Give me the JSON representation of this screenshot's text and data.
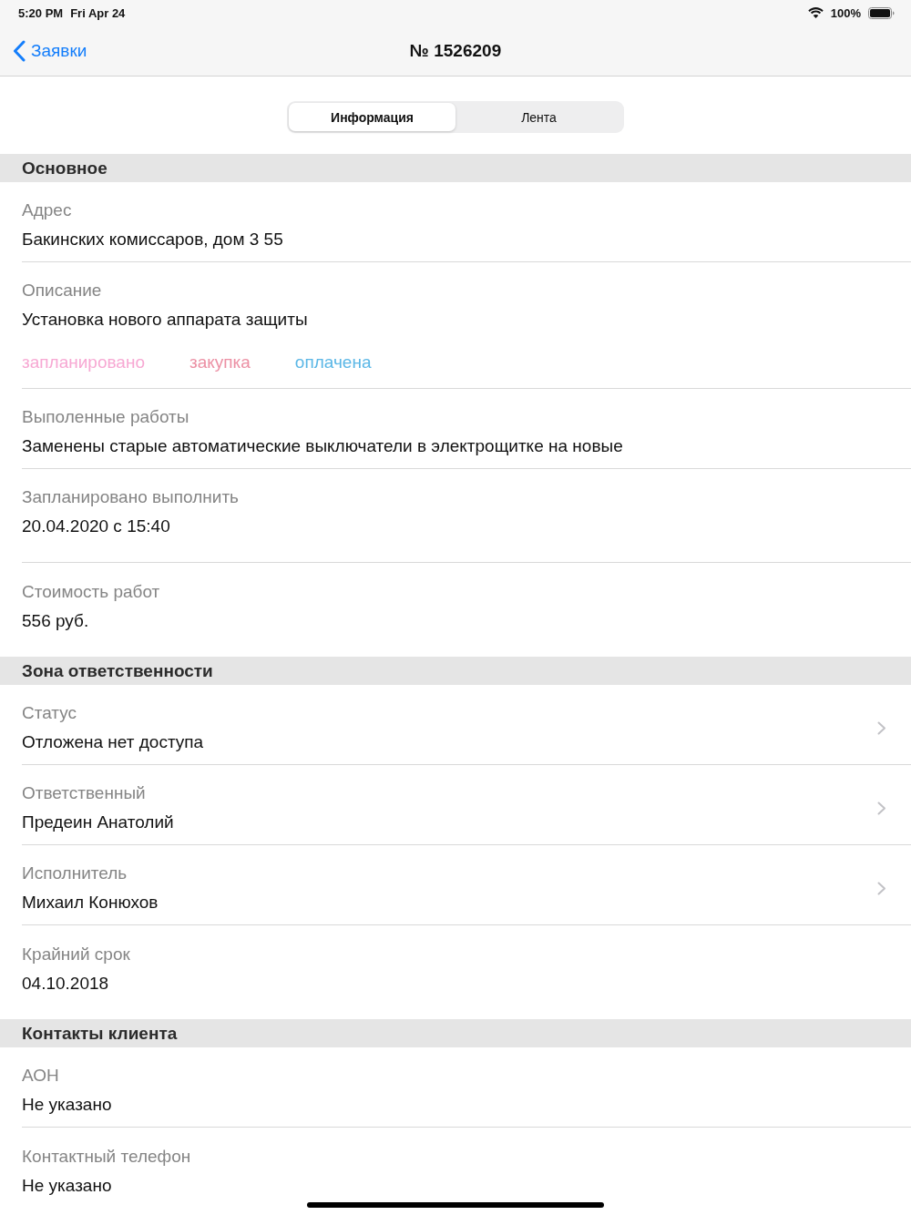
{
  "status_bar": {
    "time": "5:20 PM",
    "date": "Fri Apr 24",
    "battery": "100%"
  },
  "nav_bar": {
    "back": "Заявки",
    "title": "№ 1526209"
  },
  "segments": [
    {
      "label": "Информация",
      "selected": true
    },
    {
      "label": "Лента",
      "selected": false
    }
  ],
  "sections": [
    {
      "title": "Основное",
      "rows": [
        {
          "kind": "text",
          "label": "Адрес",
          "value": "Бакинских комиссаров, дом 3 55"
        },
        {
          "kind": "text",
          "label": "Описание",
          "value": "Установка нового аппарата защиты",
          "tags": [
            {
              "text": "запланировано",
              "color": "#f7a8d3"
            },
            {
              "text": "закупка",
              "color": "#ec90a4"
            },
            {
              "text": "оплачена",
              "color": "#5bb7e6"
            }
          ]
        },
        {
          "kind": "text",
          "label": "Выполенные работы",
          "value": "Заменены старые автоматические выключатели в электрощитке на новые"
        },
        {
          "kind": "date",
          "label": "Запланировано выполнить",
          "value": "20.04.2020 с 15:40"
        },
        {
          "kind": "text",
          "label": "Стоимость работ",
          "value": "556 руб."
        }
      ]
    },
    {
      "title": "Зона ответственности",
      "rows": [
        {
          "kind": "picker",
          "label": "Статус",
          "value": "Отложена нет доступа"
        },
        {
          "kind": "picker",
          "label": "Ответственный",
          "value": "Предеин Анатолий"
        },
        {
          "kind": "picker",
          "label": "Исполнитель",
          "value": "Михаил Конюхов"
        },
        {
          "kind": "date",
          "label": "Крайний срок",
          "value": "04.10.2018"
        }
      ]
    },
    {
      "title": "Контакты клиента",
      "rows": [
        {
          "kind": "text",
          "label": "АОН",
          "value": "Не указано"
        },
        {
          "kind": "text",
          "label": "Контактный телефон",
          "value": "Не указано"
        }
      ]
    }
  ]
}
